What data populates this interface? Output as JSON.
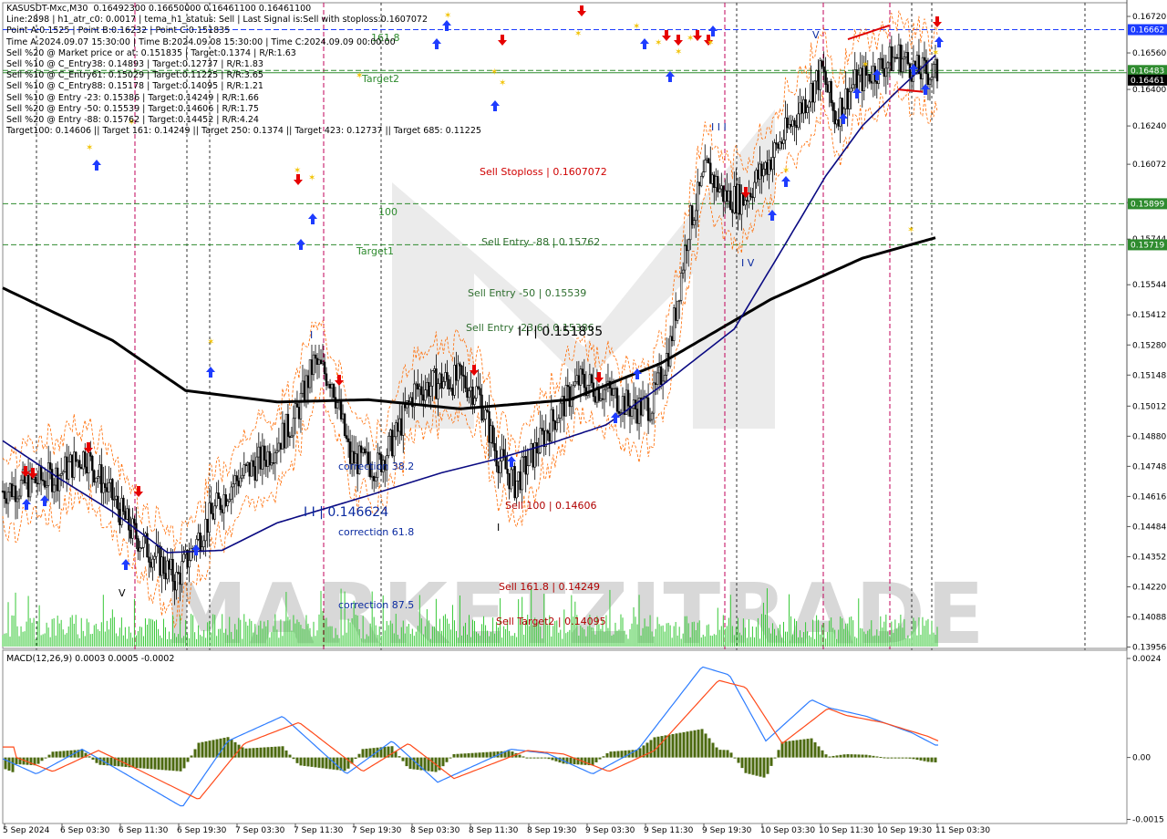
{
  "header": {
    "lines": [
      "KASUSDT-Mxc,M30  0.16492300 0.16650000 0.16461100 0.16461100",
      "Line:2898 | h1_atr_c0: 0.0017 | tema_h1_status: Sell | Last Signal is:Sell with stoploss:0.1607072",
      "Point A:0.1525 | Point B:0.16232 | Point C:0.151835",
      "Time A:2024.09.07 15:30:00 | Time B:2024.09.08 15:30:00 | Time C:2024.09.09 00:00:00",
      "Sell %20 @ Market price or at: 0.151835 | Target:0.1374 | R/R:1.63",
      "Sell %10 @ C_Entry38: 0.14893 | Target:0.12737 | R/R:1.83",
      "Sell %10 @ C_Entry61: 0.15029 | Target:0.11225 | R/R:3.65",
      "Sell %10 @ C_Entry88: 0.15178 | Target:0.14095 | R/R:1.21",
      "Sell %10 @ Entry -23: 0.15386 | Target:0.14249 | R/R:1.66",
      "Sell %20 @ Entry -50: 0.15539 | Target:0.14606 | R/R:1.75",
      "Sell %20 @ Entry -88: 0.15762 | Target:0.14452 | R/R:4.24",
      "Target100: 0.14606 || Target 161: 0.14249 || Target 250: 0.1374 || Target 423: 0.12737 || Target 685: 0.11225"
    ]
  },
  "colors": {
    "bull_candle": "#000000",
    "bear_candle": "#000000",
    "ma_slow": "#000000",
    "ma_fast": "#0a0a82",
    "channel": "#ff6a00",
    "vline": "#c0005a",
    "level_blue": "#1c3cff",
    "level_green": "#2e8b2e",
    "arrow_up": "#1e3cff",
    "arrow_down": "#e60000",
    "macd_hist": "#4c6a10",
    "macd_main": "#2e7dff",
    "macd_signal": "#ff4a1a",
    "watermark": "#d8d8d8"
  },
  "chart_labels": [
    {
      "text": "161.8",
      "color": "#2e8b2e"
    },
    {
      "text": "Target2",
      "color": "#2e8b2e"
    },
    {
      "text": "100",
      "color": "#2e8b2e"
    },
    {
      "text": "Target1",
      "color": "#2e8b2e"
    },
    {
      "text": "Sell Stoploss | 0.1607072",
      "color": "#d00000"
    },
    {
      "text": "Sell Entry -88 | 0.15762",
      "color": "#2e6e2e"
    },
    {
      "text": "Sell Entry -50 | 0.15539",
      "color": "#2e6e2e"
    },
    {
      "text": "Sell Entry -23.6 | 0.15386",
      "color": "#2e6e2e"
    },
    {
      "text": "I I | 0.151835",
      "color": "#000000"
    },
    {
      "text": "Sell 100 | 0.14606",
      "color": "#b00000"
    },
    {
      "text": "Sell 161.8 | 0.14249",
      "color": "#b00000"
    },
    {
      "text": "Sell Target2 | 0.14095",
      "color": "#b00000"
    },
    {
      "text": "correction 38.2",
      "color": "#0a2aa0"
    },
    {
      "text": "correction 61.8",
      "color": "#0a2aa0"
    },
    {
      "text": "correction 87.5",
      "color": "#0a2aa0"
    },
    {
      "text": "I I | 0.146624",
      "color": "#0a2aa0"
    },
    {
      "text": "I",
      "color": "#0a2aa0"
    },
    {
      "text": "I I I",
      "color": "#0a2aa0"
    },
    {
      "text": "I V",
      "color": "#0a2aa0"
    },
    {
      "text": "V",
      "color": "#0a2aa0"
    },
    {
      "text": "I",
      "color": "#000000"
    },
    {
      "text": "V",
      "color": "#000000"
    }
  ],
  "watermark": {
    "text": "MARKETZITRADE"
  },
  "price_axis": {
    "ticks": [
      "0.16720",
      "0.16560",
      "0.16400",
      "0.16240",
      "0.16072",
      "0.15904",
      "0.15744",
      "0.15544",
      "0.15412",
      "0.15280",
      "0.15148",
      "0.15012",
      "0.14880",
      "0.14748",
      "0.14616",
      "0.14484",
      "0.14352",
      "0.14220",
      "0.14088",
      "0.13956"
    ],
    "markers": [
      {
        "text": "0.16662",
        "color": "#1c3cff"
      },
      {
        "text": "0.16483",
        "color": "#2e8b2e"
      },
      {
        "text": "0.16461",
        "color": "#000000"
      },
      {
        "text": "0.15899",
        "color": "#2e8b2e"
      },
      {
        "text": "0.15719",
        "color": "#2e8b2e"
      }
    ]
  },
  "time_axis": {
    "labels": [
      "5 Sep 2024",
      "6 Sep 03:30",
      "6 Sep 11:30",
      "6 Sep 19:30",
      "7 Sep 03:30",
      "7 Sep 11:30",
      "7 Sep 19:30",
      "8 Sep 03:30",
      "8 Sep 11:30",
      "8 Sep 19:30",
      "9 Sep 03:30",
      "9 Sep 11:30",
      "9 Sep 19:30",
      "10 Sep 03:30",
      "10 Sep 11:30",
      "10 Sep 19:30",
      "11 Sep 03:30"
    ]
  },
  "macd": {
    "label": "MACD(12,26,9) 0.0003 0.0005 -0.0002",
    "ticks": [
      "0.0024",
      "0.00",
      "-0.0015"
    ]
  },
  "chart_data": {
    "type": "candlestick",
    "symbol": "KASUSDT-Mxc",
    "timeframe": "M30",
    "ylim": [
      0.1395,
      0.1678
    ],
    "levels": [
      {
        "name": "161.8",
        "value": 0.16662
      },
      {
        "name": "Target2",
        "value": 0.16483
      },
      {
        "name": "100",
        "value": 0.15899
      },
      {
        "name": "Target1",
        "value": 0.15719
      }
    ],
    "sell_stoploss": 0.1607072,
    "sell_entries": [
      0.15762,
      0.15539,
      0.15386
    ],
    "sell_targets": [
      0.14606,
      0.14249,
      0.14095
    ],
    "ma_slow_anchors": [
      [
        0,
        0.1553
      ],
      [
        60,
        0.153
      ],
      [
        100,
        0.1508
      ],
      [
        150,
        0.1503
      ],
      [
        200,
        0.1504
      ],
      [
        250,
        0.15
      ],
      [
        310,
        0.1504
      ],
      [
        360,
        0.152
      ],
      [
        420,
        0.1548
      ],
      [
        470,
        0.1566
      ],
      [
        510,
        0.1575
      ]
    ],
    "ma_fast_anchors": [
      [
        0,
        0.1486
      ],
      [
        30,
        0.147
      ],
      [
        60,
        0.1455
      ],
      [
        90,
        0.1437
      ],
      [
        120,
        0.1438
      ],
      [
        150,
        0.145
      ],
      [
        200,
        0.1462
      ],
      [
        240,
        0.1472
      ],
      [
        270,
        0.1478
      ],
      [
        300,
        0.1485
      ],
      [
        330,
        0.1493
      ],
      [
        360,
        0.151
      ],
      [
        400,
        0.1535
      ],
      [
        430,
        0.1575
      ],
      [
        450,
        0.1602
      ],
      [
        470,
        0.1624
      ],
      [
        490,
        0.164
      ],
      [
        510,
        0.1655
      ]
    ],
    "price_anchors": [
      [
        0,
        0.1464
      ],
      [
        30,
        0.1471
      ],
      [
        45,
        0.148
      ],
      [
        60,
        0.1461
      ],
      [
        70,
        0.1447
      ],
      [
        80,
        0.1438
      ],
      [
        95,
        0.1425
      ],
      [
        110,
        0.1448
      ],
      [
        125,
        0.1467
      ],
      [
        145,
        0.148
      ],
      [
        160,
        0.1496
      ],
      [
        170,
        0.152
      ],
      [
        180,
        0.1513
      ],
      [
        190,
        0.1478
      ],
      [
        205,
        0.1475
      ],
      [
        215,
        0.1488
      ],
      [
        225,
        0.1508
      ],
      [
        240,
        0.1512
      ],
      [
        250,
        0.1513
      ],
      [
        260,
        0.1507
      ],
      [
        270,
        0.148
      ],
      [
        280,
        0.1467
      ],
      [
        290,
        0.148
      ],
      [
        300,
        0.1494
      ],
      [
        315,
        0.1512
      ],
      [
        330,
        0.1508
      ],
      [
        345,
        0.15
      ],
      [
        355,
        0.1502
      ],
      [
        365,
        0.1528
      ],
      [
        375,
        0.158
      ],
      [
        385,
        0.1605
      ],
      [
        395,
        0.1593
      ],
      [
        405,
        0.1592
      ],
      [
        420,
        0.161
      ],
      [
        435,
        0.163
      ],
      [
        448,
        0.1648
      ],
      [
        455,
        0.1628
      ],
      [
        465,
        0.1642
      ],
      [
        480,
        0.165
      ],
      [
        490,
        0.1655
      ],
      [
        500,
        0.1648
      ],
      [
        510,
        0.1647
      ]
    ],
    "volume_range": [
      0,
      1
    ],
    "macd_ylim": [
      -0.0016,
      0.0026
    ]
  }
}
